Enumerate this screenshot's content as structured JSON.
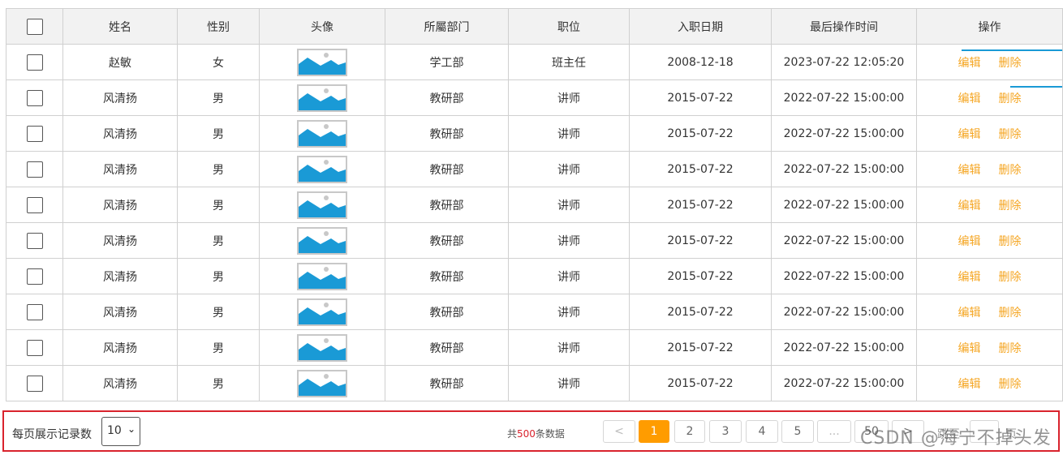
{
  "table": {
    "headers": [
      "",
      "姓名",
      "性别",
      "头像",
      "所屬部门",
      "职位",
      "入职日期",
      "最后操作时间",
      "操作"
    ],
    "rows": [
      {
        "name": "赵敏",
        "gender": "女",
        "dept": "学工部",
        "position": "班主任",
        "entry_date": "2008-12-18",
        "last_op": "2023-07-22 12:05:20",
        "edit": "编辑",
        "delete": "删除"
      },
      {
        "name": "风清扬",
        "gender": "男",
        "dept": "教研部",
        "position": "讲师",
        "entry_date": "2015-07-22",
        "last_op": "2022-07-22 15:00:00",
        "edit": "编辑",
        "delete": "删除"
      },
      {
        "name": "风清扬",
        "gender": "男",
        "dept": "教研部",
        "position": "讲师",
        "entry_date": "2015-07-22",
        "last_op": "2022-07-22 15:00:00",
        "edit": "编辑",
        "delete": "删除"
      },
      {
        "name": "风清扬",
        "gender": "男",
        "dept": "教研部",
        "position": "讲师",
        "entry_date": "2015-07-22",
        "last_op": "2022-07-22 15:00:00",
        "edit": "编辑",
        "delete": "删除"
      },
      {
        "name": "风清扬",
        "gender": "男",
        "dept": "教研部",
        "position": "讲师",
        "entry_date": "2015-07-22",
        "last_op": "2022-07-22 15:00:00",
        "edit": "编辑",
        "delete": "删除"
      },
      {
        "name": "风清扬",
        "gender": "男",
        "dept": "教研部",
        "position": "讲师",
        "entry_date": "2015-07-22",
        "last_op": "2022-07-22 15:00:00",
        "edit": "编辑",
        "delete": "删除"
      },
      {
        "name": "风清扬",
        "gender": "男",
        "dept": "教研部",
        "position": "讲师",
        "entry_date": "2015-07-22",
        "last_op": "2022-07-22 15:00:00",
        "edit": "编辑",
        "delete": "删除"
      },
      {
        "name": "风清扬",
        "gender": "男",
        "dept": "教研部",
        "position": "讲师",
        "entry_date": "2015-07-22",
        "last_op": "2022-07-22 15:00:00",
        "edit": "编辑",
        "delete": "删除"
      },
      {
        "name": "风清扬",
        "gender": "男",
        "dept": "教研部",
        "position": "讲师",
        "entry_date": "2015-07-22",
        "last_op": "2022-07-22 15:00:00",
        "edit": "编辑",
        "delete": "删除"
      },
      {
        "name": "风清扬",
        "gender": "男",
        "dept": "教研部",
        "position": "讲师",
        "entry_date": "2015-07-22",
        "last_op": "2022-07-22 15:00:00",
        "edit": "编辑",
        "delete": "删除"
      }
    ]
  },
  "pagination": {
    "page_size_label": "每页展示记录数",
    "page_size_value": "10",
    "total_prefix": "共",
    "total_count": "500",
    "total_suffix": "条数据",
    "prev": "<",
    "pages": [
      "1",
      "2",
      "3",
      "4",
      "5"
    ],
    "ellipsis": "...",
    "last_page": "50",
    "next": ">",
    "jump_label": "跳至",
    "jump_suffix": "页",
    "current_page": "1"
  },
  "watermark": "CSDN @海宁不掉头发",
  "colors": {
    "action": "#f5a623",
    "active_page": "#ff9c00",
    "total_count": "#d9232d",
    "pager_border": "#d9232d",
    "avatar_fill": "#1a9ad6"
  },
  "icons": {
    "avatar": "image-placeholder-icon",
    "select": "chevron-down-icon"
  }
}
